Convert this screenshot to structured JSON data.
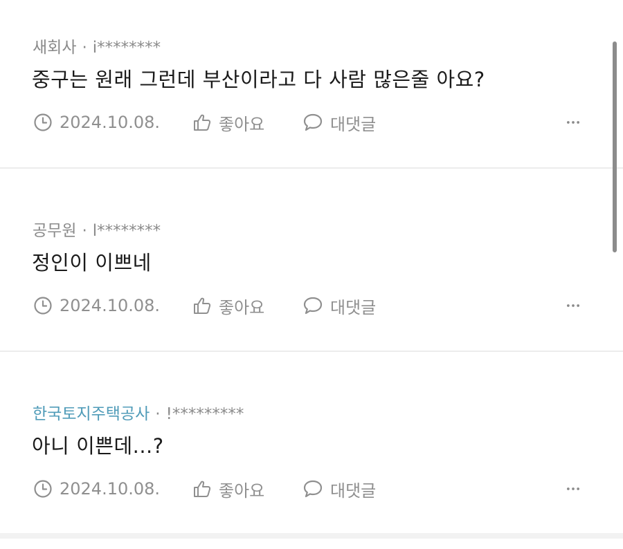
{
  "comments": [
    {
      "author": "새회사",
      "separator": "·",
      "user_id": "i********",
      "text": "중구는 원래 그런데 부산이라고 다 사람 많은줄 아요?",
      "date": "2024.10.08.",
      "like_label": "좋아요",
      "reply_label": "대댓글"
    },
    {
      "author": "공무원",
      "separator": "·",
      "user_id": "l********",
      "text": "정인이 이쁘네",
      "date": "2024.10.08.",
      "like_label": "좋아요",
      "reply_label": "대댓글"
    },
    {
      "author": "한국토지주택공사",
      "author_highlight": true,
      "author_color": "#4f9bb8",
      "separator": "·",
      "user_id": "!*********",
      "text": "아니 이쁜데...?",
      "date": "2024.10.08.",
      "like_label": "좋아요",
      "reply_label": "대댓글"
    }
  ],
  "icons": {
    "date": "clock-icon",
    "like": "thumbs-up-icon",
    "reply": "speech-bubble-icon",
    "more": "more-dots-icon"
  },
  "colors": {
    "meta_text": "#8a8a8a",
    "body_text": "#1a1a1a",
    "company_author": "#4f9bb8",
    "divider": "#ececec",
    "scrollbar": "#8c8c8c"
  }
}
